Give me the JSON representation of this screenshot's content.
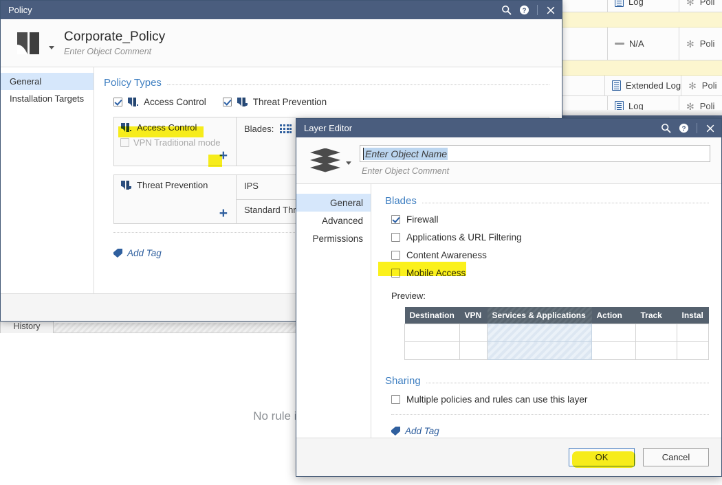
{
  "background": {
    "rule_rows": [
      {
        "track": "Log",
        "track_icon": "log-icon",
        "install_on": "Poli",
        "highlight": false
      },
      {
        "track": "",
        "track_icon": "none",
        "install_on": "",
        "highlight": true
      },
      {
        "track": "N/A",
        "track_icon": "dash-icon",
        "install_on": "Poli",
        "highlight": false
      },
      {
        "track": "",
        "track_icon": "none",
        "install_on": "",
        "highlight": true
      },
      {
        "track": "Extended Log",
        "track_icon": "log-icon",
        "install_on": "Poli",
        "highlight": false
      },
      {
        "track": "Log",
        "track_icon": "log-icon",
        "install_on": "Poli",
        "highlight": false
      }
    ],
    "tab_label": "History",
    "empty_message": "No rule is"
  },
  "policy_window": {
    "title": "Policy",
    "titlebar_icons": [
      "search-icon",
      "help-icon",
      "close-icon"
    ],
    "object": {
      "name": "Corporate_Policy",
      "comment": "Enter Object Comment",
      "icon": "policy-book-icon"
    },
    "nav": [
      {
        "label": "General",
        "selected": true
      },
      {
        "label": "Installation Targets",
        "selected": false
      }
    ],
    "section_title": "Policy Types",
    "policy_types": [
      {
        "label": "Access Control",
        "checked": true
      },
      {
        "label": "Threat Prevention",
        "checked": true
      }
    ],
    "access_card": {
      "title": "Access Control",
      "vpn_label": "VPN Traditional mode",
      "vpn_checked": false,
      "vpn_disabled": true,
      "plus_label": "+",
      "blades_label": "Blades:",
      "blade_icons": [
        "grid-dots-icon",
        "grid-squares-icon"
      ]
    },
    "threat_card": {
      "title": "Threat Prevention",
      "plus_label": "+",
      "row1": "IPS",
      "row2": "Standard Threat"
    },
    "add_tag": "Add Tag"
  },
  "layer_editor": {
    "title": "Layer Editor",
    "titlebar_icons": [
      "search-icon",
      "help-icon",
      "close-icon"
    ],
    "object": {
      "name_placeholder": "Enter Object Name",
      "comment": "Enter Object Comment",
      "icon": "layers-stack-icon"
    },
    "nav": [
      {
        "label": "General",
        "selected": true
      },
      {
        "label": "Advanced",
        "selected": false
      },
      {
        "label": "Permissions",
        "selected": false
      }
    ],
    "blades": {
      "section_title": "Blades",
      "items": [
        {
          "label": "Firewall",
          "checked": true,
          "highlighted": false
        },
        {
          "label": "Applications & URL Filtering",
          "checked": false,
          "highlighted": false
        },
        {
          "label": "Content Awareness",
          "checked": false,
          "highlighted": false
        },
        {
          "label": "Mobile Access",
          "checked": false,
          "highlighted": true
        }
      ]
    },
    "preview": {
      "label": "Preview:",
      "columns": [
        "Destination",
        "VPN",
        "Services & Applications",
        "Action",
        "Track",
        "Instal"
      ],
      "rows": [
        [
          "",
          "",
          "",
          "",
          "",
          ""
        ],
        [
          "",
          "",
          "",
          "",
          "",
          ""
        ]
      ]
    },
    "sharing": {
      "section_title": "Sharing",
      "checkbox_label": "Multiple policies and rules can use this layer",
      "checked": false
    },
    "add_tag": "Add Tag",
    "buttons": {
      "ok": "OK",
      "cancel": "Cancel"
    }
  },
  "colors": {
    "titlebar": "#4a5d7e",
    "accent_blue": "#3f7fc1",
    "selection": "#d6e7fb",
    "highlight_yellow": "#fbf11b",
    "table_header": "#55616e"
  }
}
